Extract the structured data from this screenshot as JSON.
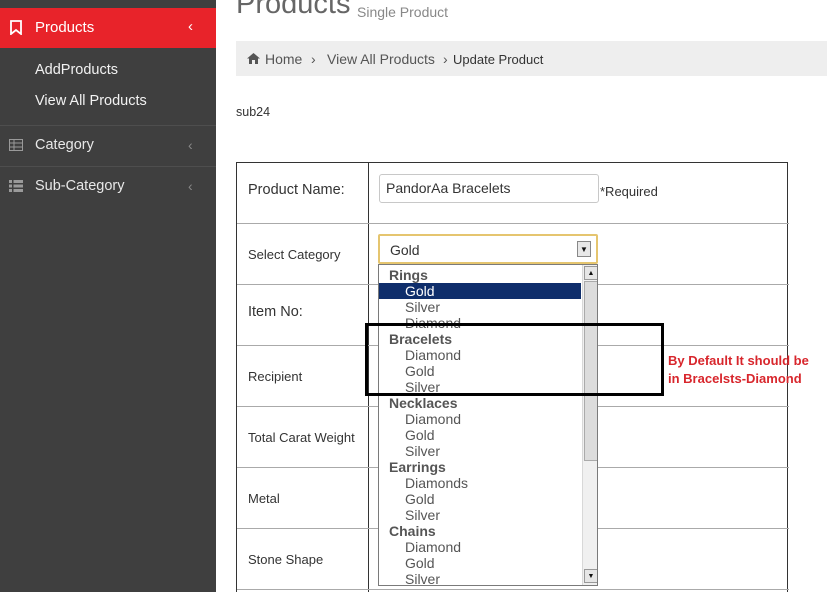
{
  "sidebar": {
    "active": {
      "label": "Products",
      "icon": "bookmark-icon"
    },
    "sub_items": [
      "AddProducts",
      "View All Products"
    ],
    "items": [
      {
        "label": "Category",
        "icon": "table-icon"
      },
      {
        "label": "Sub-Category",
        "icon": "list-icon"
      }
    ],
    "chevron": "‹"
  },
  "header": {
    "title": "Products",
    "subtitle": "Single Product"
  },
  "breadcrumb": {
    "home": "Home",
    "sep1": "›",
    "view_all": "View All Products",
    "sep2": "›",
    "current": "Update Product"
  },
  "tagline": "sub24",
  "form": {
    "product_name_label": "Product Name:",
    "product_name_value": "PandorAa Bracelets",
    "required_note": "*Required",
    "category_label": "Select Category",
    "category_value": "Gold",
    "item_no_label": "Item No:",
    "recipient_label": "Recipient",
    "carat_label": "Total Carat Weight",
    "metal_label": "Metal",
    "stone_label": "Stone Shape"
  },
  "dropdown": {
    "scroll_up": "▲",
    "scroll_down": "▼",
    "rows": [
      {
        "type": "group",
        "text": "Rings"
      },
      {
        "type": "option",
        "text": "Gold",
        "selected": true
      },
      {
        "type": "option",
        "text": "Silver"
      },
      {
        "type": "option",
        "text": "Diamond"
      },
      {
        "type": "group",
        "text": "Bracelets"
      },
      {
        "type": "option",
        "text": "Diamond"
      },
      {
        "type": "option",
        "text": "Gold"
      },
      {
        "type": "option",
        "text": "Silver"
      },
      {
        "type": "group",
        "text": "Necklaces"
      },
      {
        "type": "option",
        "text": "Diamond"
      },
      {
        "type": "option",
        "text": "Gold"
      },
      {
        "type": "option",
        "text": "Silver"
      },
      {
        "type": "group",
        "text": "Earrings"
      },
      {
        "type": "option",
        "text": "Diamonds"
      },
      {
        "type": "option",
        "text": "Gold"
      },
      {
        "type": "option",
        "text": "Silver"
      },
      {
        "type": "group",
        "text": "Chains"
      },
      {
        "type": "option",
        "text": "Diamond"
      },
      {
        "type": "option",
        "text": "Gold"
      },
      {
        "type": "option",
        "text": "Silver"
      }
    ]
  },
  "annotation": {
    "line1": "By Default It should be",
    "line2": "in Bracelsts-Diamond"
  },
  "colors": {
    "sidebar_bg": "#3f3f3f",
    "active_red": "#e8232a",
    "selected_option": "#0f2e6b",
    "annotation_text": "#d8262c"
  }
}
